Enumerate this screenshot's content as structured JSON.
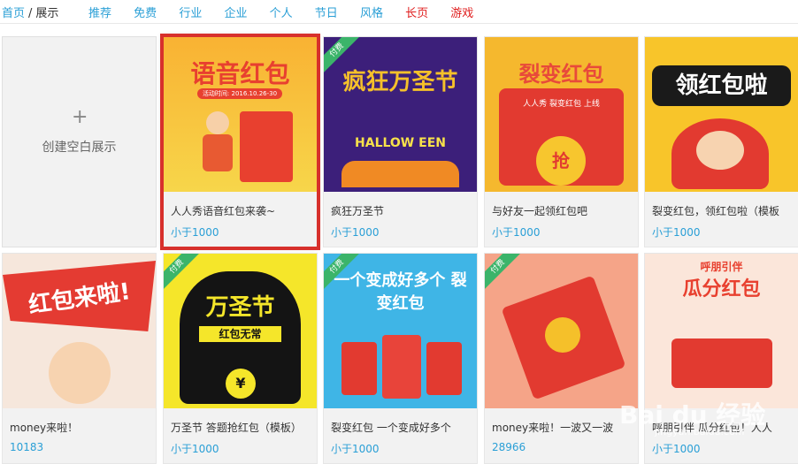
{
  "breadcrumb": {
    "home": "首页",
    "separator": "/",
    "current": "展示"
  },
  "nav": [
    {
      "label": "推荐",
      "color": "#2a9fd6"
    },
    {
      "label": "免费",
      "color": "#2a9fd6"
    },
    {
      "label": "行业",
      "color": "#2a9fd6"
    },
    {
      "label": "企业",
      "color": "#2a9fd6"
    },
    {
      "label": "个人",
      "color": "#2a9fd6"
    },
    {
      "label": "节日",
      "color": "#2a9fd6"
    },
    {
      "label": "风格",
      "color": "#2a9fd6"
    },
    {
      "label": "长页",
      "color": "#e02020"
    },
    {
      "label": "游戏",
      "color": "#e02020"
    }
  ],
  "create_card": {
    "icon": "plus-icon",
    "label": "创建空白展示"
  },
  "cards": [
    {
      "title": "人人秀语音红包来袭~",
      "price": "小于1000",
      "badge": "",
      "thumb_text": "语音红包",
      "thumb_sub": "活动时间: 2016.10.26-30",
      "selected": true
    },
    {
      "title": "疯狂万圣节",
      "price": "小于1000",
      "badge": "付费",
      "thumb_text": "疯狂万圣节",
      "thumb_sub": "HALLOW EEN"
    },
    {
      "title": "与好友一起领红包吧",
      "price": "小于1000",
      "badge": "",
      "thumb_text": "裂变红包",
      "thumb_sub": "人人秀 裂变红包 上线"
    },
    {
      "title": "裂变红包，领红包啦（模板",
      "price": "小于1000",
      "badge": "",
      "thumb_text": "领红包啦",
      "thumb_sub": ""
    },
    {
      "title": "money来啦！",
      "price": "10183",
      "badge": "",
      "thumb_text": "红包来啦!",
      "thumb_sub": ""
    },
    {
      "title": "万圣节 答题抢红包（模板）",
      "price": "小于1000",
      "badge": "付费",
      "thumb_text": "万圣节",
      "thumb_sub": "红包无常"
    },
    {
      "title": "裂变红包 一个变成好多个",
      "price": "小于1000",
      "badge": "付费",
      "thumb_text": "一个变成好多个 裂变红包",
      "thumb_sub": ""
    },
    {
      "title": "money来啦！一波又一波",
      "price": "28966",
      "badge": "付费",
      "thumb_text": "",
      "thumb_sub": ""
    },
    {
      "title": "呼朋引伴 瓜分红包！人人",
      "price": "小于1000",
      "badge": "",
      "thumb_text": "瓜分红包",
      "thumb_sub": "呼朋引伴"
    }
  ],
  "watermark": {
    "main": "Bai du 经验",
    "sub": "jingyan.baidu.com"
  }
}
